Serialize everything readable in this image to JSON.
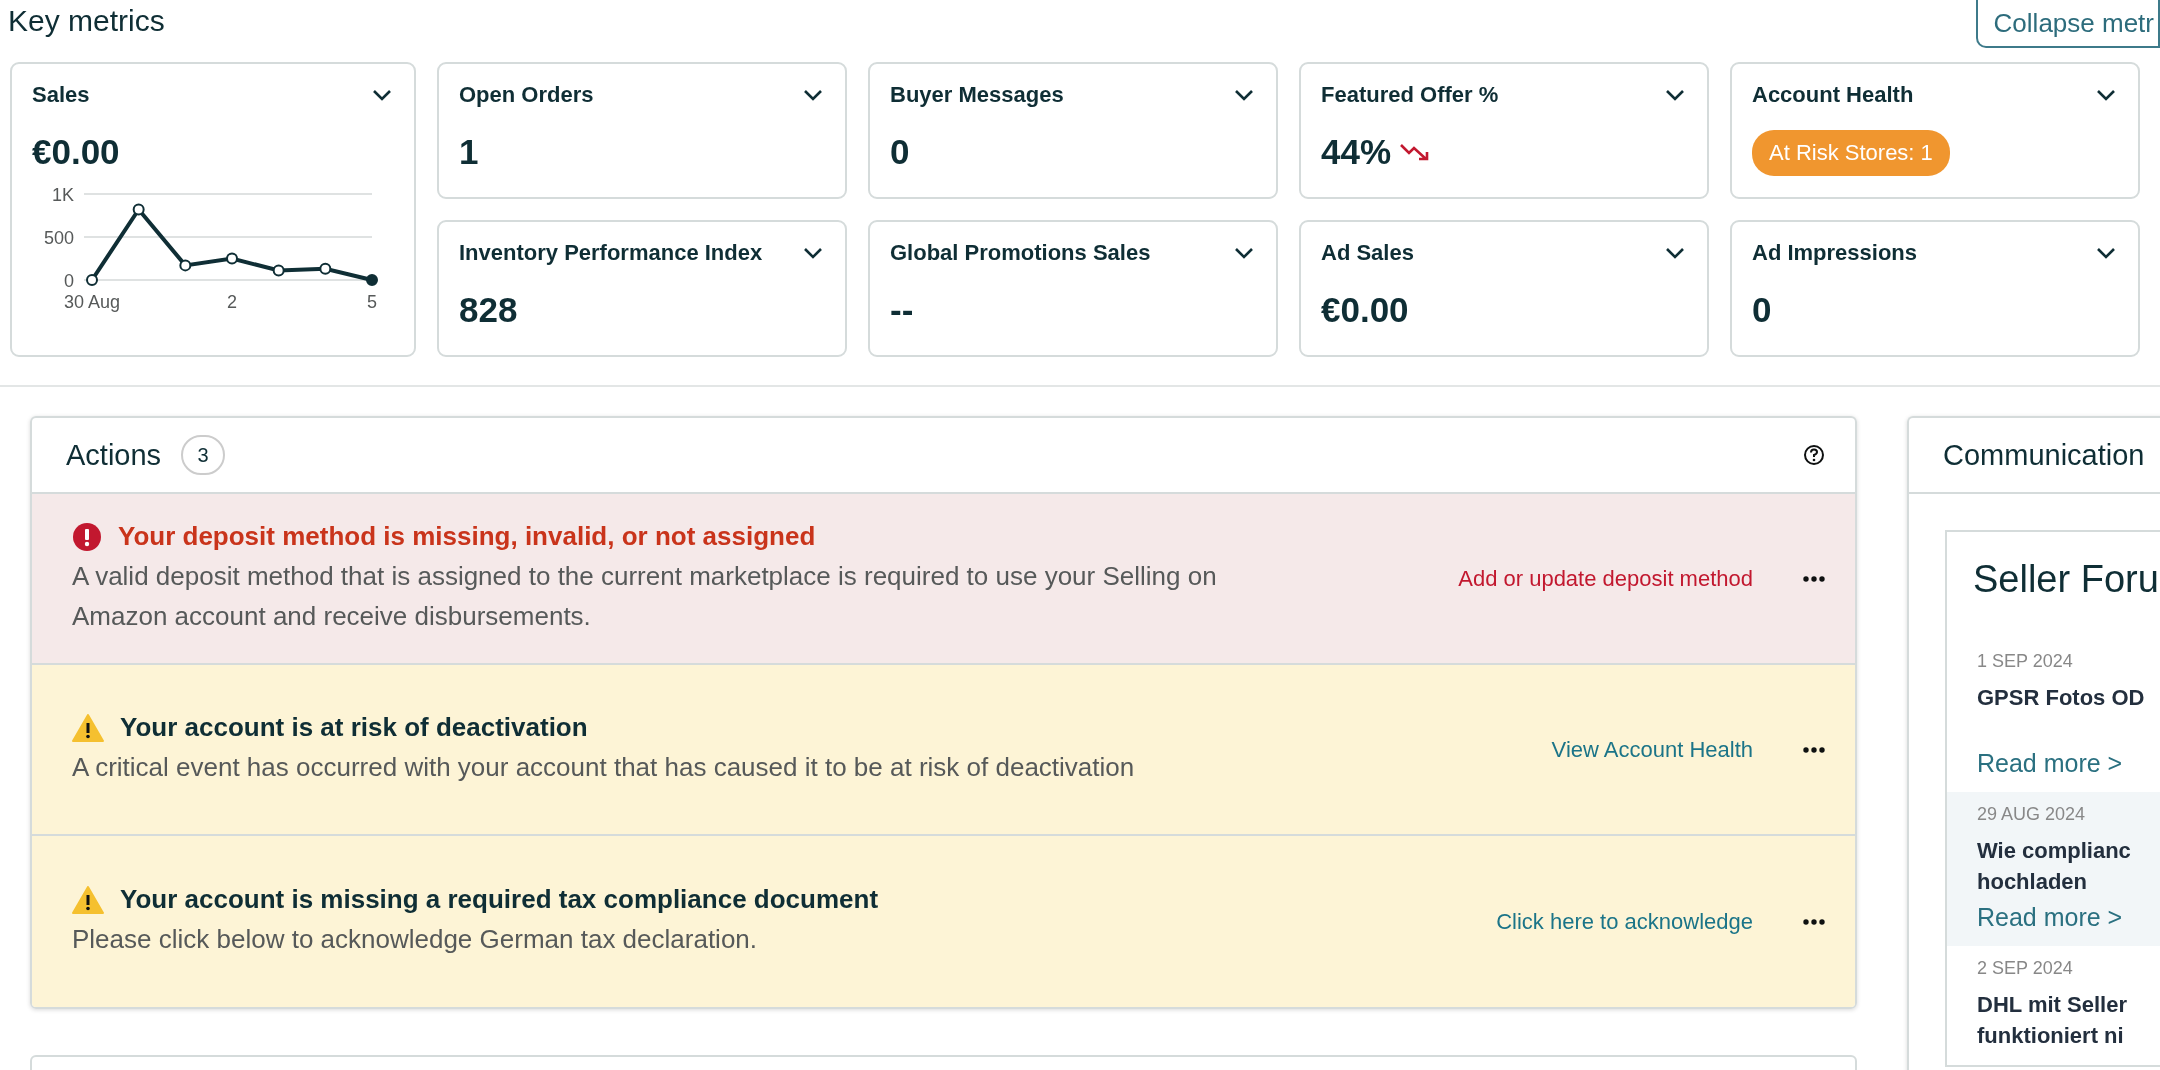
{
  "header": {
    "title": "Key metrics",
    "collapse_button": "Collapse metr"
  },
  "metrics": [
    {
      "kind": "chart",
      "title": "Sales",
      "value": "€0.00",
      "chart_data": {
        "type": "line",
        "categories": [
          "30 Aug",
          null,
          null,
          "2",
          null,
          null,
          "5"
        ],
        "yticks": [
          0,
          500,
          {
            "value": 1000,
            "label": "1K"
          }
        ],
        "ylim": [
          0,
          1000
        ],
        "series": [
          {
            "color": "#0f2e35",
            "marker": true,
            "values": [
              0,
              820,
              170,
              250,
              110,
              130,
              0
            ]
          }
        ]
      }
    },
    {
      "kind": "number",
      "title": "Open Orders",
      "value": "1"
    },
    {
      "kind": "number",
      "title": "Buyer Messages",
      "value": "0"
    },
    {
      "kind": "falling",
      "title": "Featured Offer %",
      "value": "44%"
    },
    {
      "kind": "badge",
      "title": "Account Health",
      "badge": "At Risk Stores: 1",
      "color": "#f0962f"
    },
    {
      "kind": "number",
      "title": "Inventory Performance Index",
      "value": "828"
    },
    {
      "kind": "number",
      "title": "Global Promotions Sales",
      "value": "--"
    },
    {
      "kind": "number",
      "title": "Ad Sales",
      "value": "€0.00"
    },
    {
      "kind": "number",
      "title": "Ad Impressions",
      "value": "0"
    }
  ],
  "actions": {
    "title": "Actions",
    "count": "3",
    "items": [
      {
        "kind": "error",
        "title": "Your deposit method is missing, invalid, or not assigned",
        "body": "A valid deposit method that is assigned to the current marketplace is required to use your Selling on Amazon account and receive disbursements.",
        "link": "Add or update deposit method"
      },
      {
        "kind": "warning",
        "title": "Your account is at risk of deactivation",
        "body": "A critical event has occurred with your account that has caused it to be at risk of deactivation",
        "link": "View Account Health"
      },
      {
        "kind": "warning",
        "title": "Your account is missing a required tax compliance document",
        "body": "Please click below to acknowledge German tax declaration.",
        "link": "Click here to acknowledge"
      }
    ]
  },
  "communications": {
    "title": "Communication",
    "forum_title": "Seller Foru",
    "posts": [
      {
        "date": "1 SEP 2024",
        "title": "GPSR Fotos OD",
        "read_more": "Read more >",
        "highlighted": false
      },
      {
        "date": "29 AUG 2024",
        "title": "Wie complianc hochladen",
        "read_more": "Read more >",
        "highlighted": true
      },
      {
        "date": "2 SEP 2024",
        "title": "DHL mit Seller funktioniert ni",
        "highlighted": false
      }
    ]
  }
}
